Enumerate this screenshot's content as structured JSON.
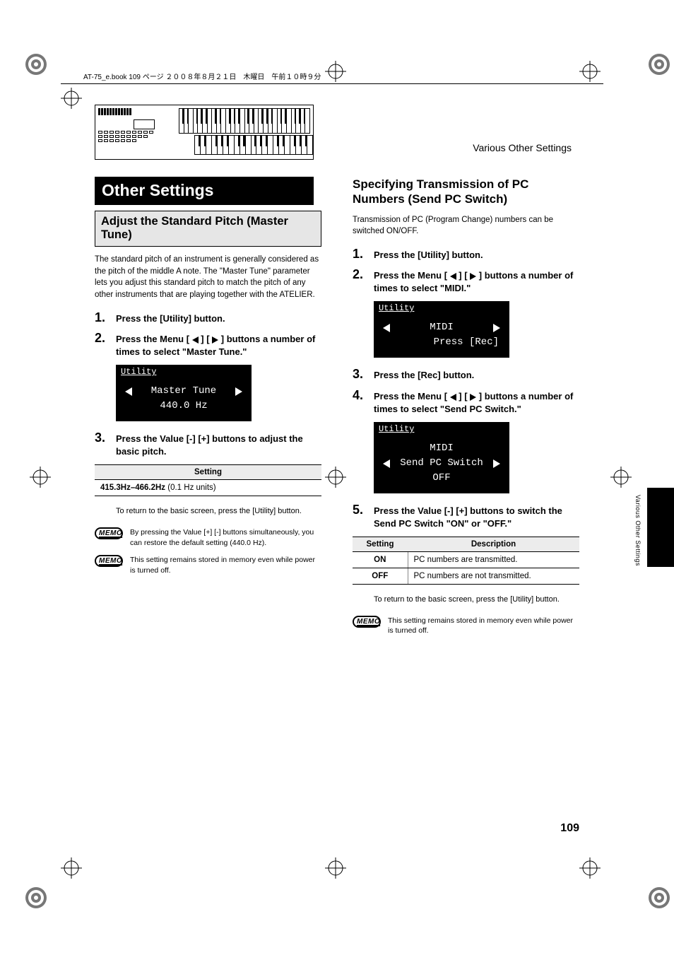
{
  "header_line": "AT-75_e.book  109 ページ  ２００８年８月２１日　木曜日　午前１０時９分",
  "running_head": "Various Other Settings",
  "side_tab_text": "Various Other Settings",
  "page_number": "109",
  "left": {
    "chapter_title": "Other Settings",
    "section_title": "Adjust the Standard Pitch (Master Tune)",
    "intro": "The standard pitch of an instrument is generally considered as the pitch of the middle A note. The \"Master Tune\" parameter lets you adjust this standard pitch to match the pitch of any other instruments that are playing together with the ATELIER.",
    "steps": [
      {
        "num": "1.",
        "text": "Press the [Utility] button."
      },
      {
        "num": "2.",
        "text_pre": "Press the Menu [ ",
        "text_mid": " ] [ ",
        "text_post": " ] buttons a number of times to select \"Master Tune.\""
      },
      {
        "num": "3.",
        "text": "Press the Value [-] [+] buttons to adjust the basic pitch."
      }
    ],
    "lcd": {
      "title": "Utility",
      "line1": "Master Tune",
      "line2": "440.0 Hz"
    },
    "table_header": "Setting",
    "table_value_bold": "415.3Hz–466.2Hz",
    "table_value_rest": " (0.1 Hz units)",
    "return_note": "To return to the basic screen, press the [Utility] button.",
    "memos": [
      "By pressing the Value [+] [-] buttons simultaneously, you can restore the default setting (440.0 Hz).",
      "This setting remains stored in memory even while power is turned off."
    ],
    "memo_label": "MEMO"
  },
  "right": {
    "section_title": "Specifying Transmission of PC Numbers (Send PC Switch)",
    "intro": "Transmission of PC (Program Change) numbers can be switched ON/OFF.",
    "steps": [
      {
        "num": "1.",
        "text": "Press the [Utility] button."
      },
      {
        "num": "2.",
        "text_pre": "Press the Menu [ ",
        "text_mid": " ] [ ",
        "text_post": " ] buttons a number of times to select \"MIDI.\""
      },
      {
        "num": "3.",
        "text": "Press the [Rec] button."
      },
      {
        "num": "4.",
        "text_pre": "Press the Menu [ ",
        "text_mid": " ] [ ",
        "text_post": " ] buttons a number of times to select \"Send PC Switch.\""
      },
      {
        "num": "5.",
        "text": "Press the Value [-] [+] buttons to switch the Send PC Switch \"ON\" or \"OFF.\""
      }
    ],
    "lcd1": {
      "title": "Utility",
      "line1": "MIDI",
      "line2": "Press [Rec]"
    },
    "lcd2": {
      "title": "Utility",
      "line1": "MIDI",
      "line2": "Send PC Switch",
      "line3": "OFF"
    },
    "table": {
      "h1": "Setting",
      "h2": "Description",
      "rows": [
        {
          "s": "ON",
          "d": "PC numbers are transmitted."
        },
        {
          "s": "OFF",
          "d": "PC numbers are not transmitted."
        }
      ]
    },
    "return_note": "To return to the basic screen, press the [Utility] button.",
    "memo": "This setting remains stored in memory even while power is turned off.",
    "memo_label": "MEMO"
  }
}
